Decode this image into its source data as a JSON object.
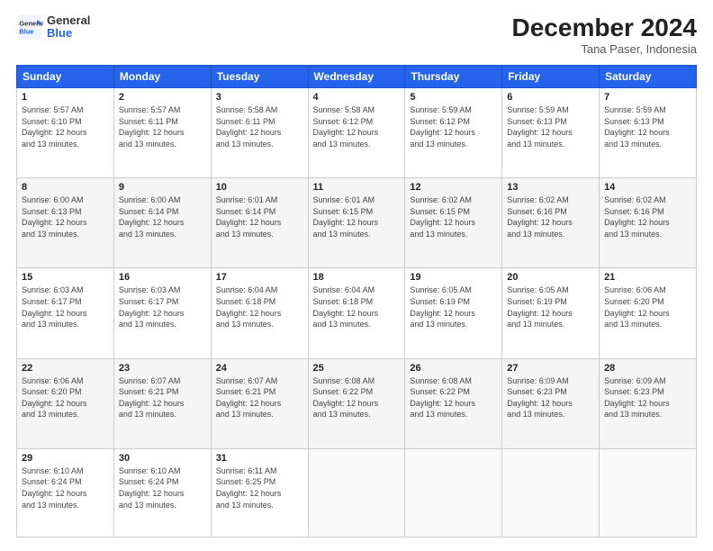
{
  "logo": {
    "general": "General",
    "blue": "Blue"
  },
  "title": "December 2024",
  "location": "Tana Paser, Indonesia",
  "days_of_week": [
    "Sunday",
    "Monday",
    "Tuesday",
    "Wednesday",
    "Thursday",
    "Friday",
    "Saturday"
  ],
  "weeks": [
    [
      {
        "day": "1",
        "sunrise": "5:57 AM",
        "sunset": "6:10 PM",
        "daylight": "12 hours and 13 minutes."
      },
      {
        "day": "2",
        "sunrise": "5:57 AM",
        "sunset": "6:11 PM",
        "daylight": "12 hours and 13 minutes."
      },
      {
        "day": "3",
        "sunrise": "5:58 AM",
        "sunset": "6:11 PM",
        "daylight": "12 hours and 13 minutes."
      },
      {
        "day": "4",
        "sunrise": "5:58 AM",
        "sunset": "6:12 PM",
        "daylight": "12 hours and 13 minutes."
      },
      {
        "day": "5",
        "sunrise": "5:59 AM",
        "sunset": "6:12 PM",
        "daylight": "12 hours and 13 minutes."
      },
      {
        "day": "6",
        "sunrise": "5:59 AM",
        "sunset": "6:13 PM",
        "daylight": "12 hours and 13 minutes."
      },
      {
        "day": "7",
        "sunrise": "5:59 AM",
        "sunset": "6:13 PM",
        "daylight": "12 hours and 13 minutes."
      }
    ],
    [
      {
        "day": "8",
        "sunrise": "6:00 AM",
        "sunset": "6:13 PM",
        "daylight": "12 hours and 13 minutes."
      },
      {
        "day": "9",
        "sunrise": "6:00 AM",
        "sunset": "6:14 PM",
        "daylight": "12 hours and 13 minutes."
      },
      {
        "day": "10",
        "sunrise": "6:01 AM",
        "sunset": "6:14 PM",
        "daylight": "12 hours and 13 minutes."
      },
      {
        "day": "11",
        "sunrise": "6:01 AM",
        "sunset": "6:15 PM",
        "daylight": "12 hours and 13 minutes."
      },
      {
        "day": "12",
        "sunrise": "6:02 AM",
        "sunset": "6:15 PM",
        "daylight": "12 hours and 13 minutes."
      },
      {
        "day": "13",
        "sunrise": "6:02 AM",
        "sunset": "6:16 PM",
        "daylight": "12 hours and 13 minutes."
      },
      {
        "day": "14",
        "sunrise": "6:02 AM",
        "sunset": "6:16 PM",
        "daylight": "12 hours and 13 minutes."
      }
    ],
    [
      {
        "day": "15",
        "sunrise": "6:03 AM",
        "sunset": "6:17 PM",
        "daylight": "12 hours and 13 minutes."
      },
      {
        "day": "16",
        "sunrise": "6:03 AM",
        "sunset": "6:17 PM",
        "daylight": "12 hours and 13 minutes."
      },
      {
        "day": "17",
        "sunrise": "6:04 AM",
        "sunset": "6:18 PM",
        "daylight": "12 hours and 13 minutes."
      },
      {
        "day": "18",
        "sunrise": "6:04 AM",
        "sunset": "6:18 PM",
        "daylight": "12 hours and 13 minutes."
      },
      {
        "day": "19",
        "sunrise": "6:05 AM",
        "sunset": "6:19 PM",
        "daylight": "12 hours and 13 minutes."
      },
      {
        "day": "20",
        "sunrise": "6:05 AM",
        "sunset": "6:19 PM",
        "daylight": "12 hours and 13 minutes."
      },
      {
        "day": "21",
        "sunrise": "6:06 AM",
        "sunset": "6:20 PM",
        "daylight": "12 hours and 13 minutes."
      }
    ],
    [
      {
        "day": "22",
        "sunrise": "6:06 AM",
        "sunset": "6:20 PM",
        "daylight": "12 hours and 13 minutes."
      },
      {
        "day": "23",
        "sunrise": "6:07 AM",
        "sunset": "6:21 PM",
        "daylight": "12 hours and 13 minutes."
      },
      {
        "day": "24",
        "sunrise": "6:07 AM",
        "sunset": "6:21 PM",
        "daylight": "12 hours and 13 minutes."
      },
      {
        "day": "25",
        "sunrise": "6:08 AM",
        "sunset": "6:22 PM",
        "daylight": "12 hours and 13 minutes."
      },
      {
        "day": "26",
        "sunrise": "6:08 AM",
        "sunset": "6:22 PM",
        "daylight": "12 hours and 13 minutes."
      },
      {
        "day": "27",
        "sunrise": "6:09 AM",
        "sunset": "6:23 PM",
        "daylight": "12 hours and 13 minutes."
      },
      {
        "day": "28",
        "sunrise": "6:09 AM",
        "sunset": "6:23 PM",
        "daylight": "12 hours and 13 minutes."
      }
    ],
    [
      {
        "day": "29",
        "sunrise": "6:10 AM",
        "sunset": "6:24 PM",
        "daylight": "12 hours and 13 minutes."
      },
      {
        "day": "30",
        "sunrise": "6:10 AM",
        "sunset": "6:24 PM",
        "daylight": "12 hours and 13 minutes."
      },
      {
        "day": "31",
        "sunrise": "6:11 AM",
        "sunset": "6:25 PM",
        "daylight": "12 hours and 13 minutes."
      },
      null,
      null,
      null,
      null
    ]
  ]
}
